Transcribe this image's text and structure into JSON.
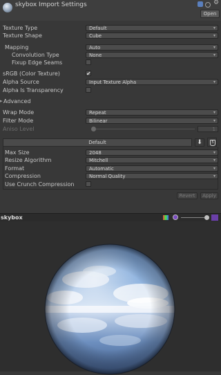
{
  "header": {
    "title": "skybox Import Settings",
    "open_label": "Open"
  },
  "fields": {
    "texture_type": {
      "label": "Texture Type",
      "value": "Default"
    },
    "texture_shape": {
      "label": "Texture Shape",
      "value": "Cube"
    },
    "mapping": {
      "label": "Mapping",
      "value": "Auto"
    },
    "convolution_type": {
      "label": "Convolution Type",
      "value": "None"
    },
    "fixup_edge_seams": {
      "label": "Fixup Edge Seams",
      "checked": false
    },
    "srgb": {
      "label": "sRGB (Color Texture)",
      "checked": true,
      "mark": "✔"
    },
    "alpha_source": {
      "label": "Alpha Source",
      "value": "Input Texture Alpha"
    },
    "alpha_is_transparency": {
      "label": "Alpha Is Transparency",
      "checked": false
    },
    "advanced": {
      "label": "Advanced",
      "expanded": false,
      "arrow": "▸"
    },
    "wrap_mode": {
      "label": "Wrap Mode",
      "value": "Repeat"
    },
    "filter_mode": {
      "label": "Filter Mode",
      "value": "Bilinear"
    },
    "aniso_level": {
      "label": "Aniso Level",
      "value": "1",
      "enabled": false
    }
  },
  "platform": {
    "tab_label": "Default",
    "download_icon": "⬇",
    "html5_icon": "5",
    "max_size": {
      "label": "Max Size",
      "value": "2048"
    },
    "resize_algorithm": {
      "label": "Resize Algorithm",
      "value": "Mitchell"
    },
    "format": {
      "label": "Format",
      "value": "Automatic"
    },
    "compression": {
      "label": "Compression",
      "value": "Normal Quality"
    },
    "use_crunch": {
      "label": "Use Crunch Compression",
      "checked": false
    }
  },
  "buttons": {
    "revert": "Revert",
    "apply": "Apply"
  },
  "preview": {
    "title": "skybox",
    "mip_level": 1.0
  },
  "icons": {
    "dropdown_arrow": "▾",
    "gear": "⚙"
  },
  "colors": {
    "panel_bg": "#383838",
    "preview_bg": "#2e2e2e",
    "accent_blue": "#5a7fbd",
    "accent_purple": "#7a4bc0"
  }
}
